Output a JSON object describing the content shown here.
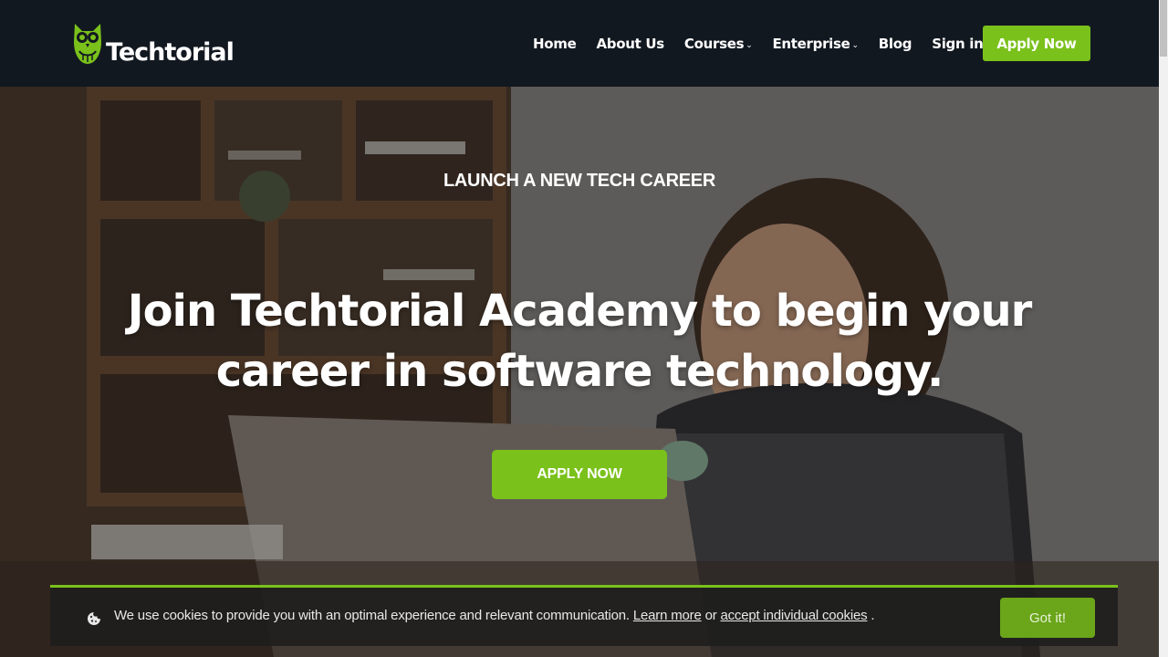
{
  "brand": {
    "name": "Techtorial",
    "accent_color": "#7ac11b",
    "header_bg": "#121820"
  },
  "nav": {
    "items": [
      {
        "label": "Home",
        "has_dropdown": false
      },
      {
        "label": "About Us",
        "has_dropdown": false
      },
      {
        "label": "Courses",
        "has_dropdown": true
      },
      {
        "label": "Enterprise",
        "has_dropdown": true
      },
      {
        "label": "Blog",
        "has_dropdown": false
      },
      {
        "label": "Sign in",
        "has_dropdown": false
      }
    ],
    "cta_label": "Apply Now"
  },
  "hero": {
    "kicker": "LAUNCH A NEW TECH CAREER",
    "headline_line1": "Join Techtorial Academy to begin your",
    "headline_line2": "career in software technology.",
    "cta_label": "APPLY NOW"
  },
  "cookie_banner": {
    "text": "We use cookies to provide you with an optimal experience and relevant communication.",
    "learn_more": "Learn more",
    "or": "or",
    "accept_individual": "accept individual cookies",
    "period": ".",
    "button_label": "Got it!",
    "icon": "cookie-icon"
  }
}
